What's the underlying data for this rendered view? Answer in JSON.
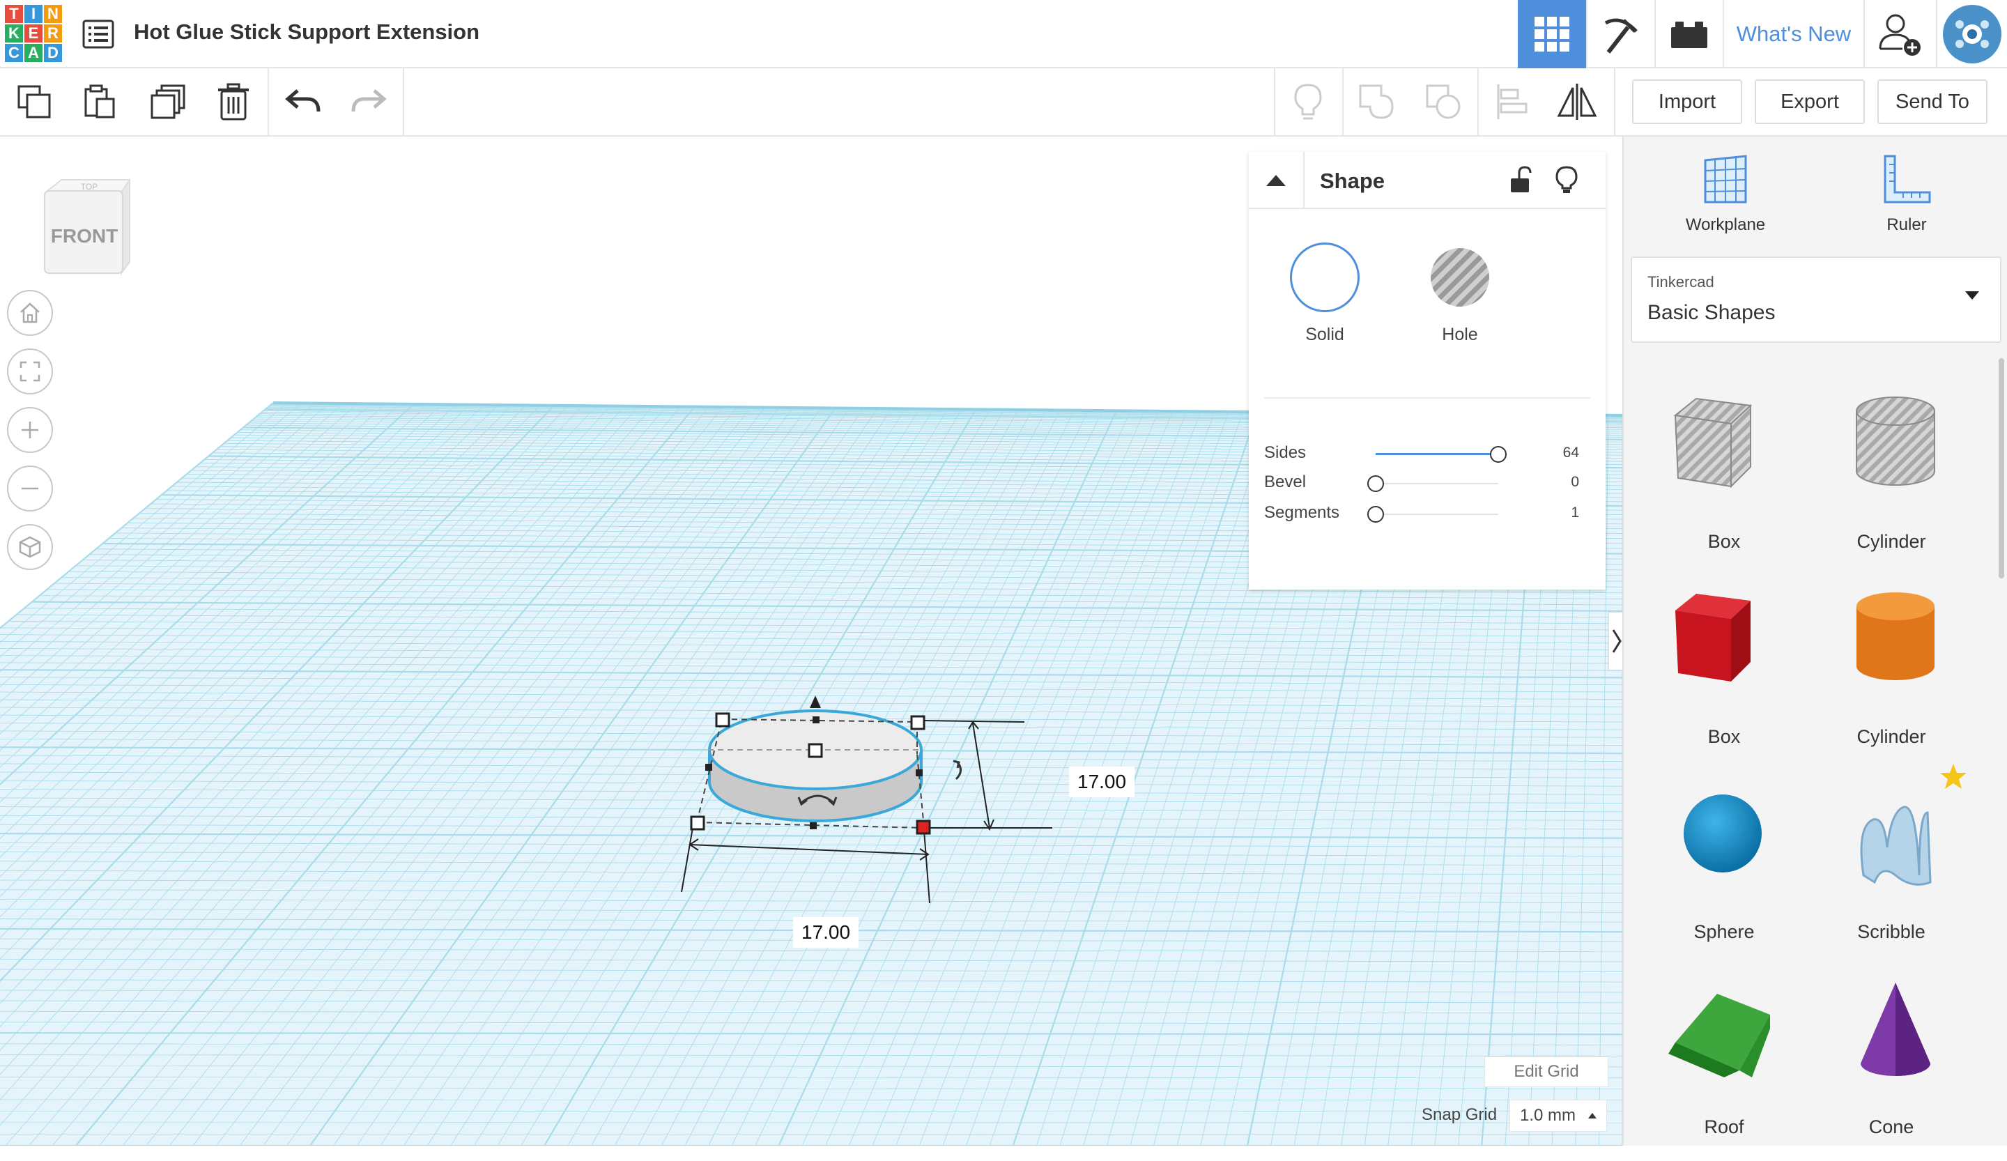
{
  "app": {
    "logo_letters": [
      "T",
      "I",
      "N",
      "K",
      "E",
      "R",
      "C",
      "A",
      "D"
    ],
    "logo_colors": [
      "#e74c3c",
      "#3498db",
      "#f39c12",
      "#27ae60",
      "#e74c3c",
      "#f39c12",
      "#3498db",
      "#27ae60",
      "#3498db"
    ],
    "design_title": "Hot Glue Stick Support Extension",
    "accent_color": "#4e8edb"
  },
  "topbar": {
    "whats_new_label": "What's New",
    "icons": [
      "list-icon",
      "grid-icon",
      "pickaxe-icon",
      "brick-icon",
      "user-add-icon",
      "avatar"
    ]
  },
  "toolbar": {
    "icons": [
      "copy-icon",
      "paste-icon",
      "duplicate-icon",
      "delete-icon",
      "undo-icon",
      "redo-icon",
      "note-icon",
      "group-icon",
      "ungroup-icon",
      "align-icon",
      "mirror-icon"
    ],
    "import_label": "Import",
    "export_label": "Export",
    "send_to_label": "Send To"
  },
  "viewport": {
    "view_cube_front": "FRONT",
    "view_cube_top": "TOP",
    "nav_icons": [
      "home-icon",
      "fit-view-icon",
      "zoom-in-icon",
      "zoom-out-icon",
      "ortho-view-icon"
    ],
    "dimension_width": "17.00",
    "dimension_length": "17.00",
    "edit_grid_label": "Edit Grid",
    "snap_grid_label": "Snap Grid",
    "snap_grid_value": "1.0 mm",
    "grid_color": "#a9dcea",
    "plane_color": "#e4f4fa"
  },
  "inspector": {
    "title": "Shape",
    "solid_label": "Solid",
    "hole_label": "Hole",
    "params": [
      {
        "label": "Sides",
        "value": "64",
        "fraction": 1.0
      },
      {
        "label": "Bevel",
        "value": "0",
        "fraction": 0.0
      },
      {
        "label": "Segments",
        "value": "1",
        "fraction": 0.0
      }
    ]
  },
  "sidebar": {
    "workplane_label": "Workplane",
    "ruler_label": "Ruler",
    "library_caption": "Tinkercad",
    "library_value": "Basic Shapes",
    "shapes": [
      {
        "label": "Box",
        "kind": "box-hole"
      },
      {
        "label": "Cylinder",
        "kind": "cylinder-hole"
      },
      {
        "label": "Box",
        "kind": "box"
      },
      {
        "label": "Cylinder",
        "kind": "cylinder"
      },
      {
        "label": "Sphere",
        "kind": "sphere"
      },
      {
        "label": "Scribble",
        "kind": "scribble"
      },
      {
        "label": "Roof",
        "kind": "roof"
      },
      {
        "label": "Cone",
        "kind": "cone"
      }
    ]
  }
}
